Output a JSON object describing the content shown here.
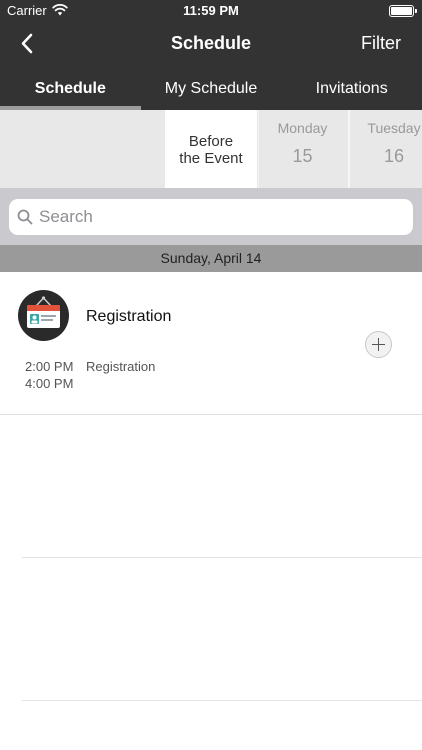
{
  "status_bar": {
    "carrier": "Carrier",
    "time": "11:59 PM"
  },
  "nav": {
    "title": "Schedule",
    "filter_label": "Filter"
  },
  "tabs": [
    {
      "label": "Schedule",
      "active": true
    },
    {
      "label": "My Schedule",
      "active": false
    },
    {
      "label": "Invitations",
      "active": false
    }
  ],
  "days": {
    "before_line1": "Before",
    "before_line2": "the Event",
    "items": [
      {
        "name": "Monday",
        "number": "15"
      },
      {
        "name": "Tuesday",
        "number": "16"
      }
    ]
  },
  "search": {
    "placeholder": "Search",
    "value": ""
  },
  "date_header": "Sunday, April 14",
  "events": [
    {
      "title": "Registration",
      "start": "2:00 PM",
      "end": "4:00 PM",
      "location": "Registration",
      "icon": "id-badge-icon"
    }
  ],
  "colors": {
    "header_bg": "#333333",
    "tab_indicator": "#9d9d9d",
    "day_strip_bg": "#e8e8e8",
    "search_area_bg": "#c9c9ce",
    "date_header_bg": "#9a9a9a",
    "badge_red": "#e0523a",
    "badge_teal": "#3aa6a6"
  }
}
